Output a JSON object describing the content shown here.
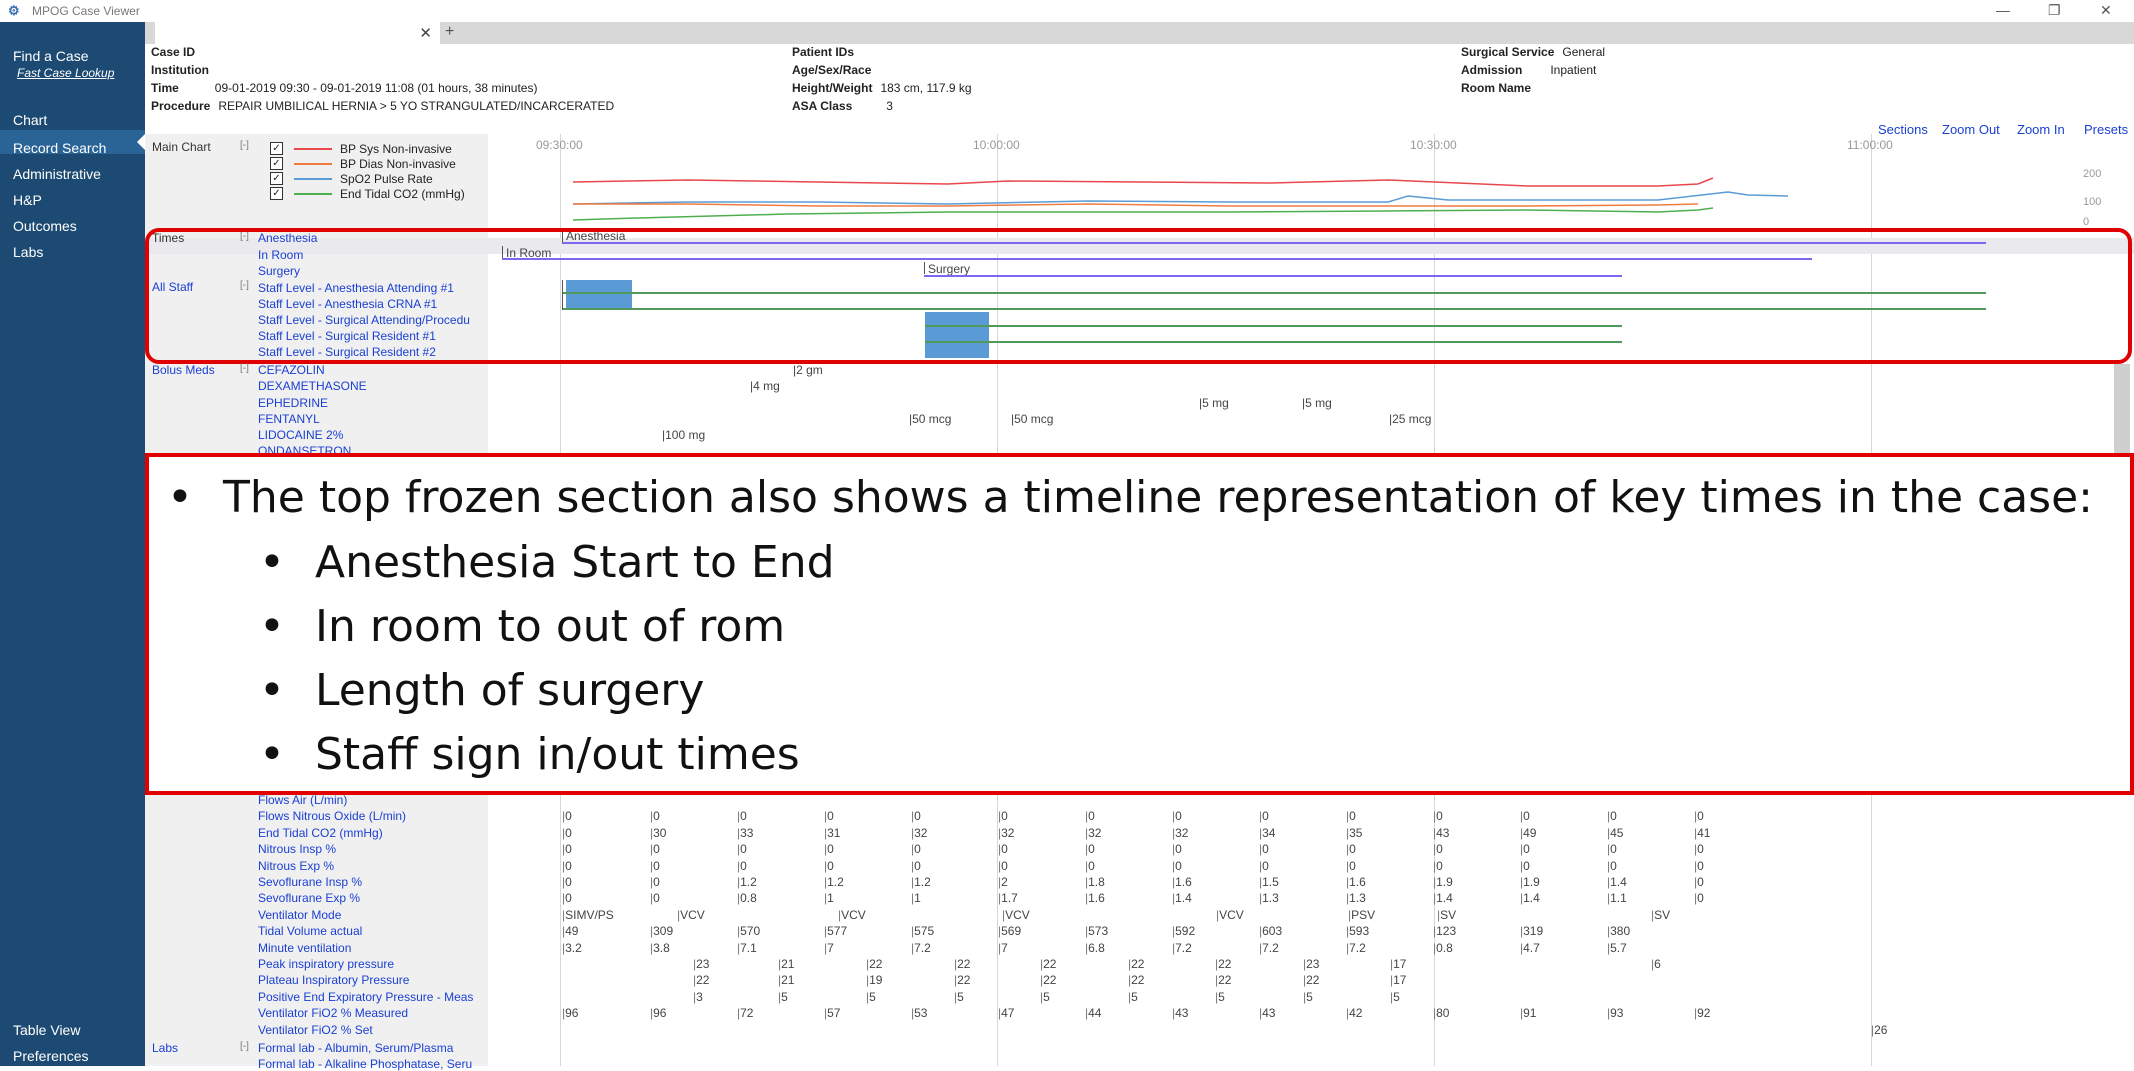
{
  "app": {
    "title": "MPOG Case Viewer",
    "window_controls": [
      "—",
      "❐",
      "✕"
    ]
  },
  "sidebar": {
    "find_case": "Find a Case",
    "fast_lookup": "Fast Case Lookup",
    "items": [
      "Chart",
      "Record Search",
      "Administrative",
      "H&P",
      "Outcomes",
      "Labs"
    ],
    "active": "Chart",
    "bottom": [
      "Table View",
      "Preferences"
    ]
  },
  "tabs": {
    "close": "✕",
    "add": "+"
  },
  "header": {
    "case_id_label": "Case ID",
    "institution_label": "Institution",
    "time_label": "Time",
    "time_value": "09-01-2019 09:30 - 09-01-2019 11:08 (01 hours, 38 minutes)",
    "procedure_label": "Procedure",
    "procedure_value": "REPAIR UMBILICAL HERNIA > 5 YO STRANGULATED/INCARCERATED",
    "patient_ids_label": "Patient IDs",
    "age_sex_race_label": "Age/Sex/Race",
    "height_weight_label": "Height/Weight",
    "height_weight_value": "183 cm, 117.9 kg",
    "asa_label": "ASA Class",
    "asa_value": "3",
    "surgical_service_label": "Surgical Service",
    "surgical_service_value": "General",
    "admission_label": "Admission",
    "admission_value": "Inpatient",
    "room_name_label": "Room Name"
  },
  "toolbar": {
    "sections": "Sections",
    "zoom_out": "Zoom Out",
    "zoom_in": "Zoom In",
    "presets": "Presets"
  },
  "time_axis": [
    "09:30:00",
    "10:00:00",
    "10:30:00",
    "11:00:00"
  ],
  "main_chart": {
    "label": "Main Chart",
    "collapse": "[-]",
    "legend": [
      {
        "name": "BP Sys Non-invasive",
        "color": "#e8474c"
      },
      {
        "name": "BP Dias Non-invasive",
        "color": "#f07b3f"
      },
      {
        "name": "SpO2 Pulse Rate",
        "color": "#5b9bd5"
      },
      {
        "name": "End Tidal CO2 (mmHg)",
        "color": "#4caf50"
      }
    ],
    "y_ticks": [
      "200",
      "100",
      "0"
    ]
  },
  "times_section": {
    "label": "Times",
    "collapse": "[-]",
    "rows": [
      "Anesthesia",
      "In Room",
      "Surgery"
    ],
    "bar_labels": [
      "Anesthesia",
      "In Room",
      "Surgery"
    ]
  },
  "staff_section": {
    "label": "All Staff",
    "collapse": "[-]",
    "rows": [
      "Staff Level - Anesthesia Attending #1",
      "Staff Level - Anesthesia CRNA #1",
      "Staff Level - Surgical Attending/Procedu",
      "Staff Level - Surgical Resident #1",
      "Staff Level - Surgical Resident #2"
    ]
  },
  "bolus_section": {
    "label": "Bolus Meds",
    "collapse": "[-]",
    "rows": [
      "CEFAZOLIN",
      "DEXAMETHASONE",
      "EPHEDRINE",
      "FENTANYL",
      "LIDOCAINE 2%",
      "ONDANSETRON"
    ],
    "doses": {
      "cefazolin": "2 gm",
      "dexamethasone": "4 mg",
      "ephedrine": [
        "5 mg",
        "5 mg"
      ],
      "fentanyl": [
        "50 mcg",
        "50 mcg",
        "25 mcg"
      ],
      "lidocaine": "100 mg"
    }
  },
  "overlay": {
    "heading": "The top frozen section also shows a timeline representation of key times in the case:",
    "bullets": [
      "Anesthesia Start to End",
      "In room to out of rom",
      "Length of surgery",
      "Staff sign in/out times"
    ]
  },
  "vent_rows": [
    {
      "label": "Flows Air (L/min)",
      "values": []
    },
    {
      "label": "Flows Nitrous Oxide (L/min)",
      "values": [
        "0",
        "0",
        "0",
        "0",
        "0",
        "0",
        "0",
        "0",
        "0",
        "0",
        "0",
        "0",
        "0",
        "0"
      ]
    },
    {
      "label": "End Tidal CO2 (mmHg)",
      "values": [
        "0",
        "30",
        "33",
        "31",
        "32",
        "32",
        "32",
        "32",
        "34",
        "35",
        "43",
        "49",
        "45",
        "41"
      ]
    },
    {
      "label": "Nitrous Insp  %",
      "values": [
        "0",
        "0",
        "0",
        "0",
        "0",
        "0",
        "0",
        "0",
        "0",
        "0",
        "0",
        "0",
        "0",
        "0"
      ]
    },
    {
      "label": "Nitrous Exp  %",
      "values": [
        "0",
        "0",
        "0",
        "0",
        "0",
        "0",
        "0",
        "0",
        "0",
        "0",
        "0",
        "0",
        "0",
        "0"
      ]
    },
    {
      "label": "Sevoflurane Insp %",
      "values": [
        "0",
        "0",
        "1.2",
        "1.2",
        "1.2",
        "2",
        "1.8",
        "1.6",
        "1.5",
        "1.6",
        "1.9",
        "1.9",
        "1.4",
        "0"
      ]
    },
    {
      "label": "Sevoflurane Exp %",
      "values": [
        "0",
        "0",
        "0.8",
        "1",
        "1",
        "1.7",
        "1.6",
        "1.4",
        "1.3",
        "1.3",
        "1.4",
        "1.4",
        "1.1",
        "0"
      ]
    },
    {
      "label": "Ventilator Mode",
      "values": [
        "SIMV/PS",
        "VCV",
        "VCV",
        "VCV",
        "VCV",
        "PSV",
        "SV",
        "SV"
      ]
    },
    {
      "label": "Tidal Volume actual",
      "values": [
        "49",
        "309",
        "570",
        "577",
        "575",
        "569",
        "573",
        "592",
        "603",
        "593",
        "123",
        "319",
        "380"
      ]
    },
    {
      "label": "Minute ventilation",
      "values": [
        "3.2",
        "3.8",
        "7.1",
        "7",
        "7.2",
        "7",
        "6.8",
        "7.2",
        "7.2",
        "7.2",
        "0.8",
        "4.7",
        "5.7"
      ]
    },
    {
      "label": "Peak inspiratory pressure",
      "values": [
        "23",
        "21",
        "22",
        "22",
        "22",
        "22",
        "22",
        "23",
        "17",
        "6"
      ]
    },
    {
      "label": "Plateau Inspiratory Pressure",
      "values": [
        "22",
        "21",
        "19",
        "22",
        "22",
        "22",
        "22",
        "22",
        "17"
      ]
    },
    {
      "label": "Positive End Expiratory Pressure - Meas",
      "values": [
        "3",
        "5",
        "5",
        "5",
        "5",
        "5",
        "5",
        "5",
        "5"
      ]
    },
    {
      "label": "Ventilator FiO2 % Measured",
      "values": [
        "96",
        "96",
        "72",
        "57",
        "53",
        "47",
        "44",
        "43",
        "43",
        "42",
        "80",
        "91",
        "93",
        "92"
      ]
    },
    {
      "label": "Ventilator FiO2 % Set",
      "values": [
        "26"
      ]
    }
  ],
  "labs_section": {
    "label": "Labs",
    "collapse": "[-]",
    "rows": [
      "Formal lab - Albumin, Serum/Plasma",
      "Formal lab - Alkaline Phosphatase, Seru"
    ]
  },
  "colors": {
    "sidebar": "#1d4a72",
    "highlight": "#e00000",
    "link": "#1a3fd4",
    "staff_block": "#5b9bd5"
  }
}
